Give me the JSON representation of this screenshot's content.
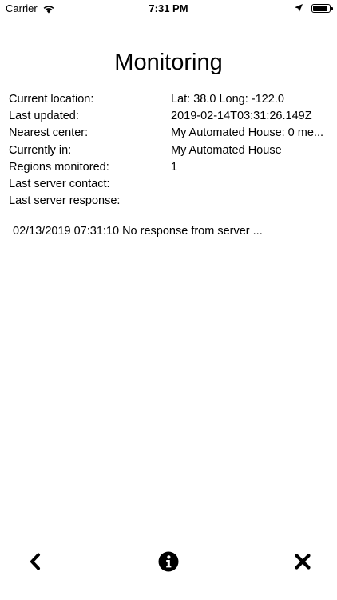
{
  "status_bar": {
    "carrier": "Carrier",
    "time": "7:31 PM",
    "battery_level": 0.95
  },
  "header": {
    "title": "Monitoring"
  },
  "info": {
    "rows": [
      {
        "label": "Current location:",
        "value": "Lat: 38.0  Long: -122.0"
      },
      {
        "label": "Last updated:",
        "value": "2019-02-14T03:31:26.149Z"
      },
      {
        "label": "Nearest center:",
        "value": "My Automated House: 0 me..."
      },
      {
        "label": "Currently in:",
        "value": "My Automated House"
      },
      {
        "label": "Regions monitored:",
        "value": "1"
      },
      {
        "label": "Last server contact:",
        "value": ""
      },
      {
        "label": "Last server response:",
        "value": ""
      }
    ]
  },
  "log": {
    "entries": [
      "02/13/2019 07:31:10 No response from server ..."
    ]
  },
  "toolbar": {
    "back_icon": "chevron-left-icon",
    "info_icon": "info-circle-icon",
    "close_icon": "close-x-icon"
  }
}
